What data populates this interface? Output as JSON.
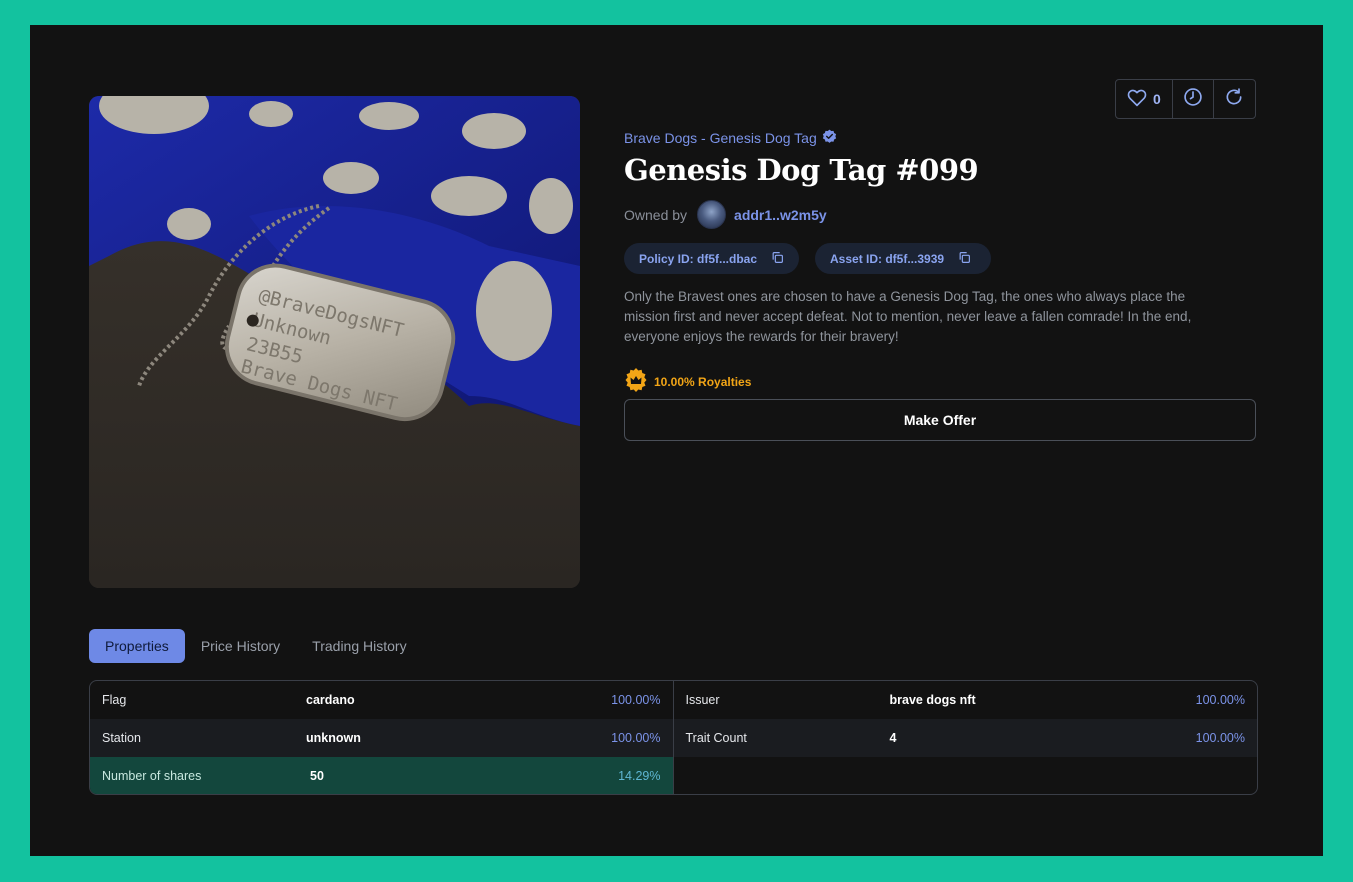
{
  "collection": {
    "name": "Brave Dogs - Genesis Dog Tag",
    "verified_icon": "verified-badge-icon"
  },
  "title": "Genesis Dog Tag #099",
  "owner": {
    "label": "Owned by",
    "address": "addr1..w2m5y"
  },
  "policy_id": "Policy ID: df5f...dbac",
  "asset_id": "Asset ID: df5f...3939",
  "description": "Only the Bravest ones are chosen to have a Genesis Dog Tag, the ones who always place the mission first and never accept defeat. Not to mention, never leave a fallen comrade! In the end, everyone enjoys the rewards for their bravery!",
  "royalties": "10.00% Royalties",
  "make_offer": "Make Offer",
  "likes": "0",
  "image": {
    "tag_text": [
      "@BraveDogsNFT",
      "Unknown",
      "23B55",
      "Brave Dogs NFT"
    ]
  },
  "tabs": [
    "Properties",
    "Price History",
    "Trading History"
  ],
  "properties_left": [
    {
      "key": "Flag",
      "value": "cardano",
      "percent": "100.00%"
    },
    {
      "key": "Station",
      "value": "unknown",
      "percent": "100.00%"
    },
    {
      "key": "Number of shares",
      "value": "50",
      "percent": "14.29%"
    }
  ],
  "properties_right": [
    {
      "key": "Issuer",
      "value": "brave dogs nft",
      "percent": "100.00%"
    },
    {
      "key": "Trait Count",
      "value": "4",
      "percent": "100.00%"
    }
  ],
  "colors": {
    "accent": "#7b93e8",
    "page_bg": "#13c29f",
    "panel_bg": "#121212",
    "royalty": "#f2a516",
    "highlight_row": "#13473d"
  }
}
